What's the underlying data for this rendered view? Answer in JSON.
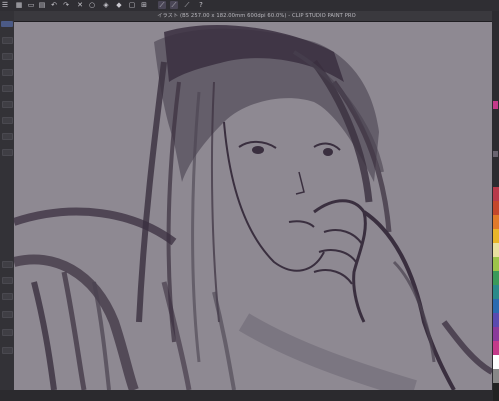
{
  "window": {
    "title": "イラスト (B5 257.00 x 182.00mm 600dpi 60.0%) - CLIP STUDIO PAINT PRO"
  },
  "toolbar": {
    "icons": [
      "menu-icon",
      "file-icon",
      "folder-icon",
      "save-icon",
      "undo-icon",
      "redo-icon",
      "clear-icon",
      "transform-icon",
      "fill-icon",
      "selection-icon",
      "ruler-icon",
      "snap-icon",
      "brush-active-icon",
      "eraser-icon",
      "help-icon"
    ]
  },
  "colors": {
    "canvas_bg": "#8e8992",
    "ink": "#3a2f3f",
    "ink_light": "#6a6470",
    "palette": [
      "#b8394a",
      "#c4472c",
      "#e07a2a",
      "#e8b52a",
      "#e8e0a0",
      "#9cc44a",
      "#3a9a5a",
      "#2a8a8a",
      "#2a6ab0",
      "#5a4ab0",
      "#8a3a9a",
      "#c43a8a",
      "#ffffff",
      "#888888",
      "#222222"
    ]
  }
}
